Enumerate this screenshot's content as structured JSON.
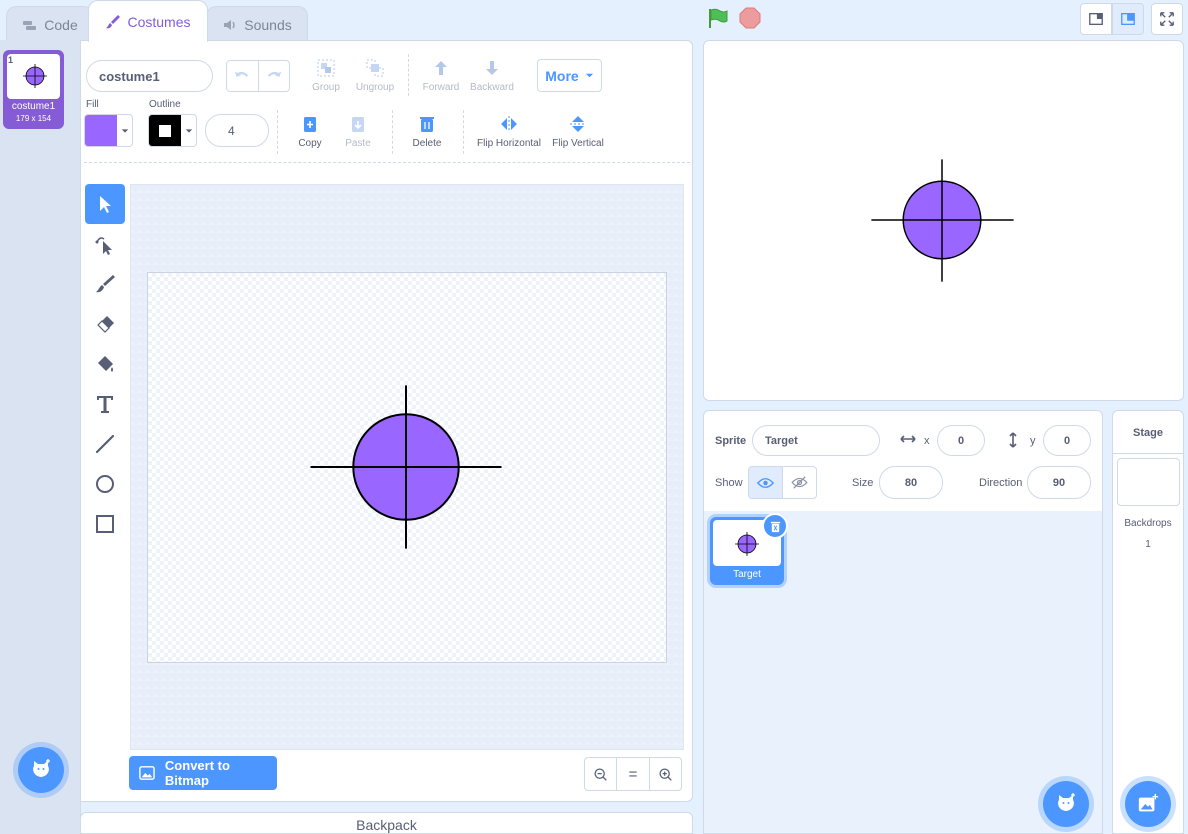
{
  "tabs": {
    "code": "Code",
    "costumes": "Costumes",
    "sounds": "Sounds"
  },
  "costume_list": [
    {
      "index": "1",
      "name": "costume1",
      "size": "179 x 154"
    }
  ],
  "toolbar": {
    "costume_name": "costume1",
    "group": "Group",
    "ungroup": "Ungroup",
    "forward": "Forward",
    "backward": "Backward",
    "more": "More",
    "fill_label": "Fill",
    "outline_label": "Outline",
    "outline_width": "4",
    "copy": "Copy",
    "paste": "Paste",
    "delete": "Delete",
    "flip_h": "Flip Horizontal",
    "flip_v": "Flip Vertical"
  },
  "colors": {
    "fill": "#9966ff",
    "outline": "#000000",
    "accent": "#855cd6",
    "primary": "#4c97ff"
  },
  "tools": [
    "select-tool",
    "reshape-tool",
    "brush-tool",
    "eraser-tool",
    "fill-tool",
    "text-tool",
    "line-tool",
    "circle-tool",
    "rectangle-tool"
  ],
  "convert_button": "Convert to Bitmap",
  "zoom": {
    "out": "−",
    "reset": "=",
    "in": "+"
  },
  "backpack": "Backpack",
  "sprite_info": {
    "sprite_label": "Sprite",
    "sprite_name": "Target",
    "x_label": "x",
    "x": "0",
    "y_label": "y",
    "y": "0",
    "show_label": "Show",
    "size_label": "Size",
    "size": "80",
    "direction_label": "Direction",
    "direction": "90"
  },
  "sprites": [
    {
      "name": "Target"
    }
  ],
  "stage_panel": {
    "title": "Stage",
    "backdrops_label": "Backdrops",
    "backdrops_count": "1"
  }
}
